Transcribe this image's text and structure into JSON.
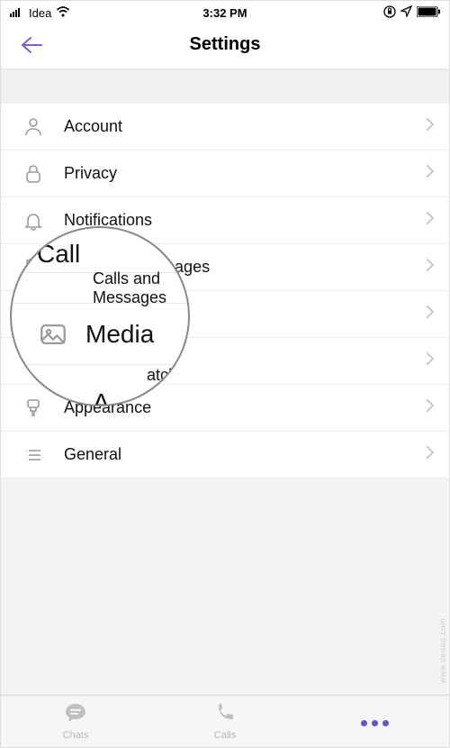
{
  "status": {
    "carrier": "Idea",
    "time": "3:32 PM"
  },
  "header": {
    "title": "Settings"
  },
  "list": {
    "account": "Account",
    "privacy": "Privacy",
    "notifications": "Notifications",
    "calls": "Calls and Messages",
    "media": "Media",
    "watch": "Apple Watch",
    "appearance": "Appearance",
    "general": "General"
  },
  "magnifier": {
    "top_partial": "Call",
    "bot_partial": "A",
    "bot_partial2": "atch",
    "media": "Media"
  },
  "tabs": {
    "chats": "Chats",
    "calls": "Calls",
    "more": ""
  },
  "watermark": "www.deuaq.com"
}
